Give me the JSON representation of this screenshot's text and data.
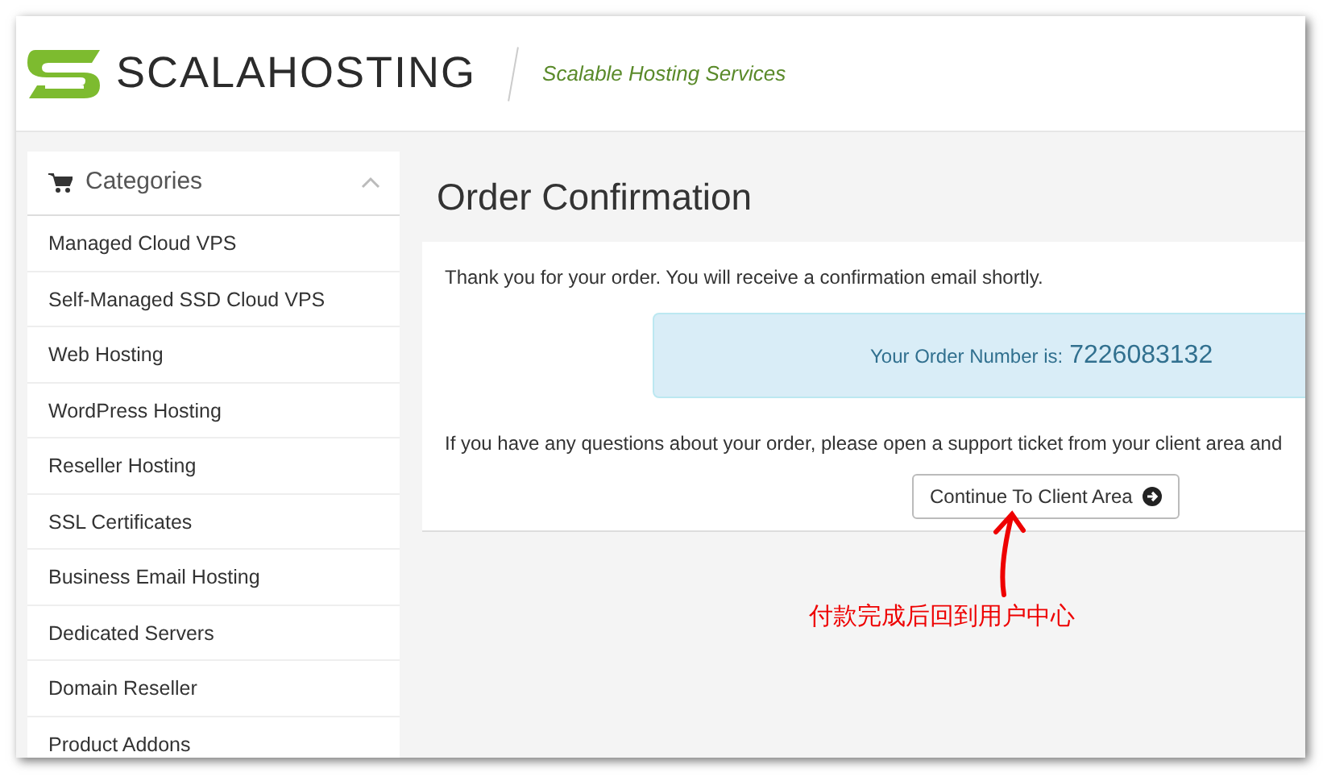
{
  "header": {
    "brand": "SCALAHOSTING",
    "tagline": "Scalable Hosting Services"
  },
  "sidebar": {
    "title": "Categories",
    "expanded": true,
    "items": [
      {
        "label": "Managed Cloud VPS"
      },
      {
        "label": "Self-Managed SSD Cloud VPS"
      },
      {
        "label": "Web Hosting"
      },
      {
        "label": "WordPress Hosting"
      },
      {
        "label": "Reseller Hosting"
      },
      {
        "label": "SSL Certificates"
      },
      {
        "label": "Business Email Hosting"
      },
      {
        "label": "Dedicated Servers"
      },
      {
        "label": "Domain Reseller"
      },
      {
        "label": "Product Addons"
      }
    ]
  },
  "main": {
    "title": "Order Confirmation",
    "thanks": "Thank you for your order. You will receive a confirmation email shortly.",
    "order_label": "Your Order Number is:",
    "order_number": "7226083132",
    "questions": "If you have any questions about your order, please open a support ticket from your client area and",
    "button": "Continue To Client Area"
  },
  "annotation": {
    "text": "付款完成后回到用户中心"
  }
}
